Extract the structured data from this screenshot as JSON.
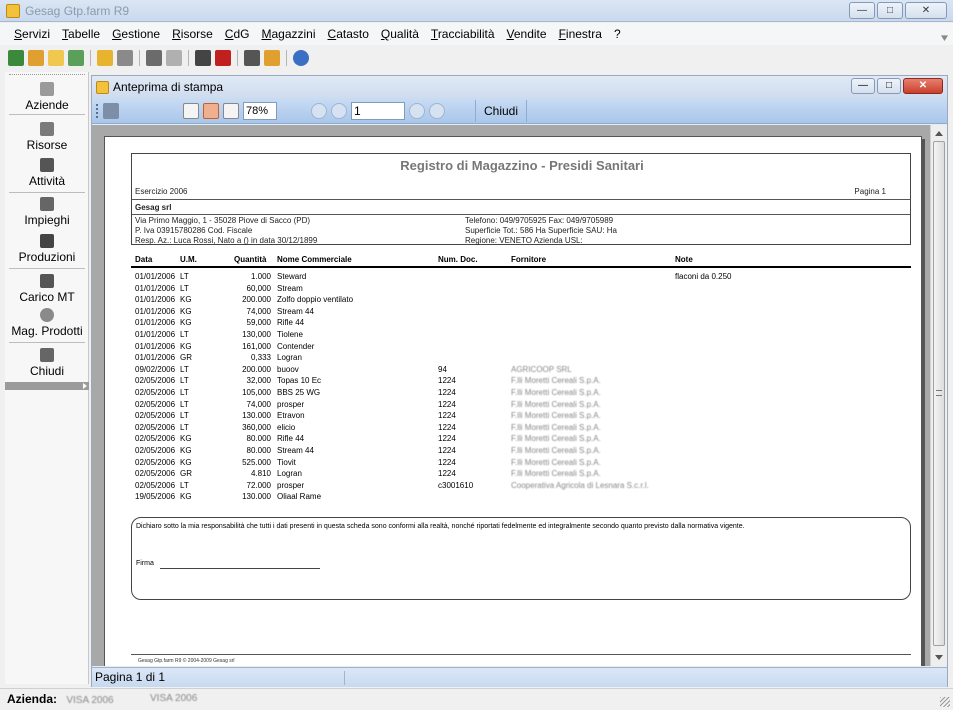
{
  "app": {
    "title": "Gesag Gtp.farm R9"
  },
  "menu": [
    "Servizi",
    "Tabelle",
    "Gestione",
    "Risorse",
    "CdG",
    "Magazzini",
    "Catasto",
    "Qualità",
    "Tracciabilità",
    "Vendite",
    "Finestra",
    "?"
  ],
  "toolbar_icons": [
    "exit-icon",
    "home-icon",
    "open-folder-icon",
    "export-icon",
    "folder-icon",
    "list-icon",
    "tools-icon",
    "chart-icon",
    "recycle-icon",
    "tractor-icon",
    "calendar-icon",
    "package-icon",
    "info-icon"
  ],
  "sidebar": {
    "items": [
      {
        "label": "Aziende",
        "icon": "folder-icon"
      },
      {
        "label": "Risorse",
        "icon": "worker-icon"
      },
      {
        "label": "Attività",
        "icon": "activity-icon"
      },
      {
        "label": "Impieghi",
        "icon": "recycle-icon"
      },
      {
        "label": "Produzioni",
        "icon": "harvest-icon"
      },
      {
        "label": "Carico MT",
        "icon": "calendar-icon"
      },
      {
        "label": "Mag. Prodotti",
        "icon": "package-icon"
      },
      {
        "label": "Chiudi",
        "icon": "exit-icon"
      }
    ]
  },
  "preview": {
    "title": "Anteprima di stampa",
    "zoom": "78%",
    "page_input": "1",
    "close_label": "Chiudi",
    "status": "Pagina 1 di 1"
  },
  "report": {
    "title": "Registro di Magazzino - Presidi Sanitari",
    "esercizio": "Esercizio 2006",
    "pagina": "Pagina 1",
    "company": "Gesag srl",
    "address": "Via Primo Maggio, 1 - 35028 Piove di Sacco (PD)",
    "piva": "P. Iva 03915780286  Cod. Fiscale",
    "resp": "Resp. Az.: Luca Rossi, Nato a  () in data 30/12/1899",
    "telefono": "Telefono: 049/9705925  Fax: 049/9705989",
    "superficie": "Superficie Tot.: 586 Ha  Superficie SAU:  Ha",
    "regione": "Regione: VENETO  Azienda USL:",
    "headers": {
      "data": "Data",
      "um": "U.M.",
      "quantita": "Quantità",
      "nome": "Nome Commerciale",
      "num_doc": "Num. Doc.",
      "fornitore": "Fornitore",
      "note": "Note"
    },
    "rows": [
      {
        "data": "01/01/2006",
        "um": "LT",
        "quantita": "1.000",
        "nome": "Steward",
        "num_doc": "",
        "fornitore": "",
        "note": "flaconi da 0.250"
      },
      {
        "data": "01/01/2006",
        "um": "LT",
        "quantita": "60,000",
        "nome": "Stream",
        "num_doc": "",
        "fornitore": "",
        "note": ""
      },
      {
        "data": "01/01/2006",
        "um": "KG",
        "quantita": "200.000",
        "nome": "Zolfo doppio ventilato",
        "num_doc": "",
        "fornitore": "",
        "note": ""
      },
      {
        "data": "01/01/2006",
        "um": "KG",
        "quantita": "74,000",
        "nome": "Stream 44",
        "num_doc": "",
        "fornitore": "",
        "note": ""
      },
      {
        "data": "01/01/2006",
        "um": "KG",
        "quantita": "59,000",
        "nome": "Rifle 44",
        "num_doc": "",
        "fornitore": "",
        "note": ""
      },
      {
        "data": "01/01/2006",
        "um": "LT",
        "quantita": "130,000",
        "nome": "Tiolene",
        "num_doc": "",
        "fornitore": "",
        "note": ""
      },
      {
        "data": "01/01/2006",
        "um": "KG",
        "quantita": "161,000",
        "nome": "Contender",
        "num_doc": "",
        "fornitore": "",
        "note": ""
      },
      {
        "data": "01/01/2006",
        "um": "GR",
        "quantita": "0,333",
        "nome": "Logran",
        "num_doc": "",
        "fornitore": "",
        "note": ""
      },
      {
        "data": "09/02/2006",
        "um": "LT",
        "quantita": "200.000",
        "nome": "buoov",
        "num_doc": "94",
        "fornitore": "AGRICOOP SRL",
        "note": ""
      },
      {
        "data": "02/05/2006",
        "um": "LT",
        "quantita": "32,000",
        "nome": "Topas 10 Ec",
        "num_doc": "1224",
        "fornitore": "F.lli Moretti Cereali S.p.A.",
        "note": ""
      },
      {
        "data": "02/05/2006",
        "um": "LT",
        "quantita": "105,000",
        "nome": "BBS 25 WG",
        "num_doc": "1224",
        "fornitore": "F.lli Moretti Cereali S.p.A.",
        "note": ""
      },
      {
        "data": "02/05/2006",
        "um": "LT",
        "quantita": "74,000",
        "nome": "prosper",
        "num_doc": "1224",
        "fornitore": "F.lli Moretti Cereali S.p.A.",
        "note": ""
      },
      {
        "data": "02/05/2006",
        "um": "LT",
        "quantita": "130.000",
        "nome": "Etravon",
        "num_doc": "1224",
        "fornitore": "F.lli Moretti Cereali S.p.A.",
        "note": ""
      },
      {
        "data": "02/05/2006",
        "um": "LT",
        "quantita": "360,000",
        "nome": "elicio",
        "num_doc": "1224",
        "fornitore": "F.lli Moretti Cereali S.p.A.",
        "note": ""
      },
      {
        "data": "02/05/2006",
        "um": "KG",
        "quantita": "80.000",
        "nome": "Rifle 44",
        "num_doc": "1224",
        "fornitore": "F.lli Moretti Cereali S.p.A.",
        "note": ""
      },
      {
        "data": "02/05/2006",
        "um": "KG",
        "quantita": "80.000",
        "nome": "Stream 44",
        "num_doc": "1224",
        "fornitore": "F.lli Moretti Cereali S.p.A.",
        "note": ""
      },
      {
        "data": "02/05/2006",
        "um": "KG",
        "quantita": "525.000",
        "nome": "Tiovit",
        "num_doc": "1224",
        "fornitore": "F.lli Moretti Cereali S.p.A.",
        "note": ""
      },
      {
        "data": "02/05/2006",
        "um": "GR",
        "quantita": "4.810",
        "nome": "Logran",
        "num_doc": "1224",
        "fornitore": "F.lli Moretti Cereali S.p.A.",
        "note": ""
      },
      {
        "data": "02/05/2006",
        "um": "LT",
        "quantita": "72.000",
        "nome": "prosper",
        "num_doc": "c3001610",
        "fornitore": "Cooperativa Agricola di Lesnara S.c.r.l.",
        "note": ""
      },
      {
        "data": "19/05/2006",
        "um": "KG",
        "quantita": "130.000",
        "nome": "Oliaal Rame",
        "num_doc": "",
        "fornitore": "",
        "note": ""
      }
    ],
    "declaration": "Dichiaro sotto la mia responsabilità che tutti i dati presenti in questa scheda sono conformi alla realtà, nonché riportati fedelmente ed integralmente secondo quanto previsto dalla normativa vigente.",
    "firma": "Firma",
    "footer": "Gesag Gtp.farm R9 © 2004-2009 Gesag srl"
  },
  "main_status": {
    "label": "Azienda:",
    "value1": "VISA 2006",
    "value2": "VISA 2006"
  }
}
